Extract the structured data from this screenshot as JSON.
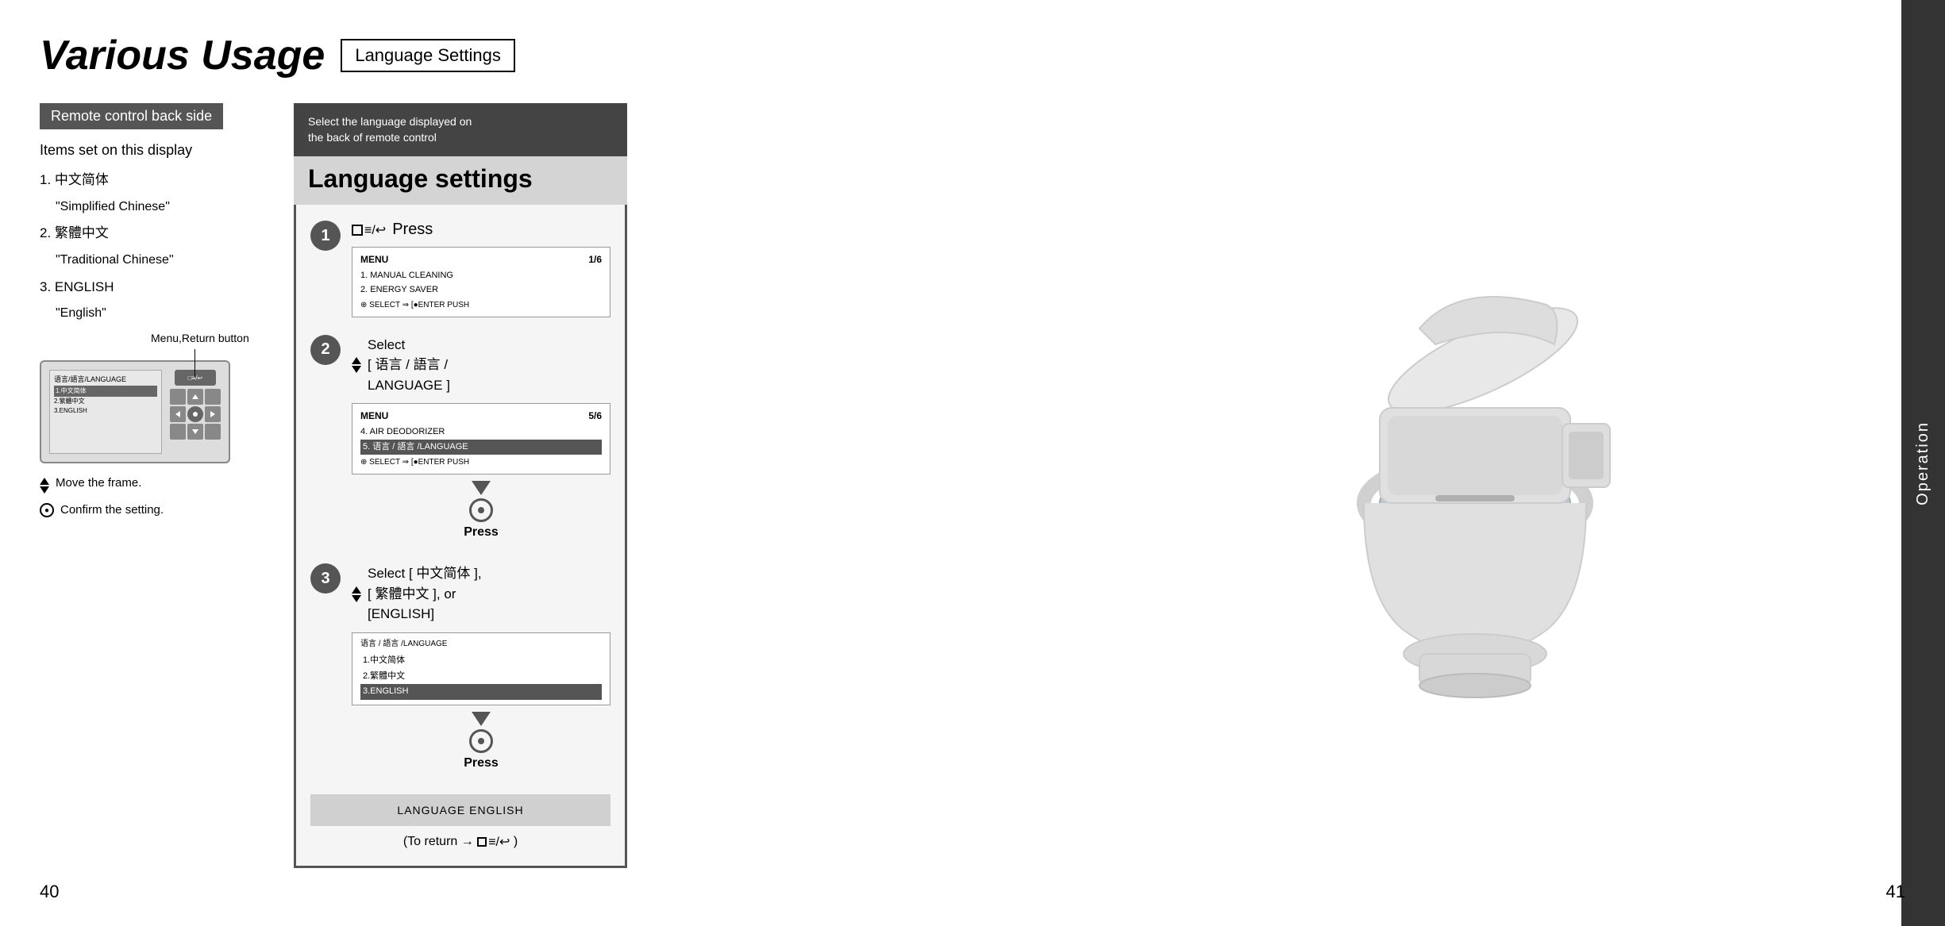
{
  "page_title": "Various Usage",
  "title_badge": "Language Settings",
  "left_page_number": "40",
  "right_page_number": "41",
  "remote_section": {
    "label": "Remote control back side",
    "items_header": "Items set on this display",
    "items": [
      {
        "num": "1.",
        "main": "中文简体",
        "sub": "\"Simplified Chinese\""
      },
      {
        "num": "2.",
        "main": "繁體中文",
        "sub": "\"Traditional Chinese\""
      },
      {
        "num": "3.",
        "main": "ENGLISH",
        "sub": "\"English\""
      }
    ],
    "annotation_menu": "Menu,Return button",
    "annotation_move": "Move the frame.",
    "annotation_confirm": "Confirm the setting."
  },
  "panel": {
    "header_small": "Select the language displayed on\nthe back of remote control",
    "header_bold": "Language settings",
    "steps": [
      {
        "number": "1",
        "action_text": "Press",
        "menu_title": "MENU",
        "menu_page": "1/6",
        "menu_items": [
          "1. MANUAL CLEANING",
          "2. ENERGY SAVER"
        ],
        "menu_footer": "⊕ SELECT ⇒ [●ENTER PUSH"
      },
      {
        "number": "2",
        "action_text": "Select",
        "select_text": "[ 语言 / 語言 /\nLANGUAGE ]",
        "menu_title": "MENU",
        "menu_page": "5/6",
        "menu_items": [
          "4. AIR DEODORIZER",
          "5. 语言 / 語言 /LANGUAGE"
        ],
        "menu_footer": "⊕ SELECT ⇒ [●ENTER PUSH",
        "press_label": "Press"
      },
      {
        "number": "3",
        "action_text": "Select",
        "select_options": "[ 中文简体 ],\n[ 繁體中文 ], or\n[ENGLISH]",
        "lang_title": "语言 / 語言 /LANGUAGE",
        "lang_items": [
          {
            "text": "1.中文简体",
            "highlighted": false
          },
          {
            "text": "2.繁體中文",
            "highlighted": false
          },
          {
            "text": "3.ENGLISH",
            "highlighted": true
          }
        ],
        "press_label": "Press"
      }
    ],
    "result_text": "LANGUAGE ENGLISH",
    "return_note": "(To return → □≡/↩ )"
  },
  "operation_label": "Operation"
}
